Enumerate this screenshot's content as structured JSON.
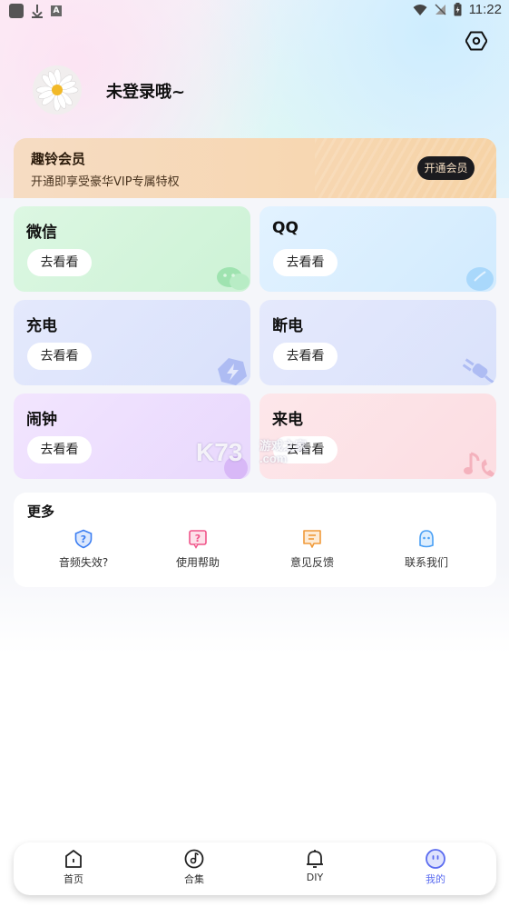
{
  "status_bar": {
    "time": "11:22"
  },
  "profile": {
    "username": "未登录哦~"
  },
  "vip": {
    "title": "趣铃会员",
    "subtitle": "开通即享受豪华VIP专属特权",
    "button": "开通会员"
  },
  "cards": [
    {
      "title": "微信",
      "button": "去看看",
      "icon": "wechat-icon"
    },
    {
      "title": "QQ",
      "button": "去看看",
      "icon": "qq-icon"
    },
    {
      "title": "充电",
      "button": "去看看",
      "icon": "charging-icon"
    },
    {
      "title": "断电",
      "button": "去看看",
      "icon": "plug-icon"
    },
    {
      "title": "闹钟",
      "button": "去看看",
      "icon": "alarm-icon"
    },
    {
      "title": "来电",
      "button": "去看看",
      "icon": "music-phone-icon"
    }
  ],
  "more": {
    "title": "更多",
    "items": [
      {
        "label": "音频失效?",
        "icon": "shield-question-icon",
        "color": "#3d7ff2"
      },
      {
        "label": "使用帮助",
        "icon": "help-icon",
        "color": "#f0558a"
      },
      {
        "label": "意见反馈",
        "icon": "feedback-icon",
        "color": "#f09a3a"
      },
      {
        "label": "联系我们",
        "icon": "contact-icon",
        "color": "#4aa0f5"
      }
    ]
  },
  "watermark": {
    "main": "K73",
    "sub1": "游戏之家",
    "sub2": ".com"
  },
  "tabs": [
    {
      "label": "首页",
      "icon": "home-icon"
    },
    {
      "label": "合集",
      "icon": "music-disc-icon"
    },
    {
      "label": "DIY",
      "icon": "bell-icon"
    },
    {
      "label": "我的",
      "icon": "profile-face-icon",
      "active": true
    }
  ],
  "colors": {
    "accent": "#5b6cf0",
    "vip_button": "#1b1b1f"
  }
}
